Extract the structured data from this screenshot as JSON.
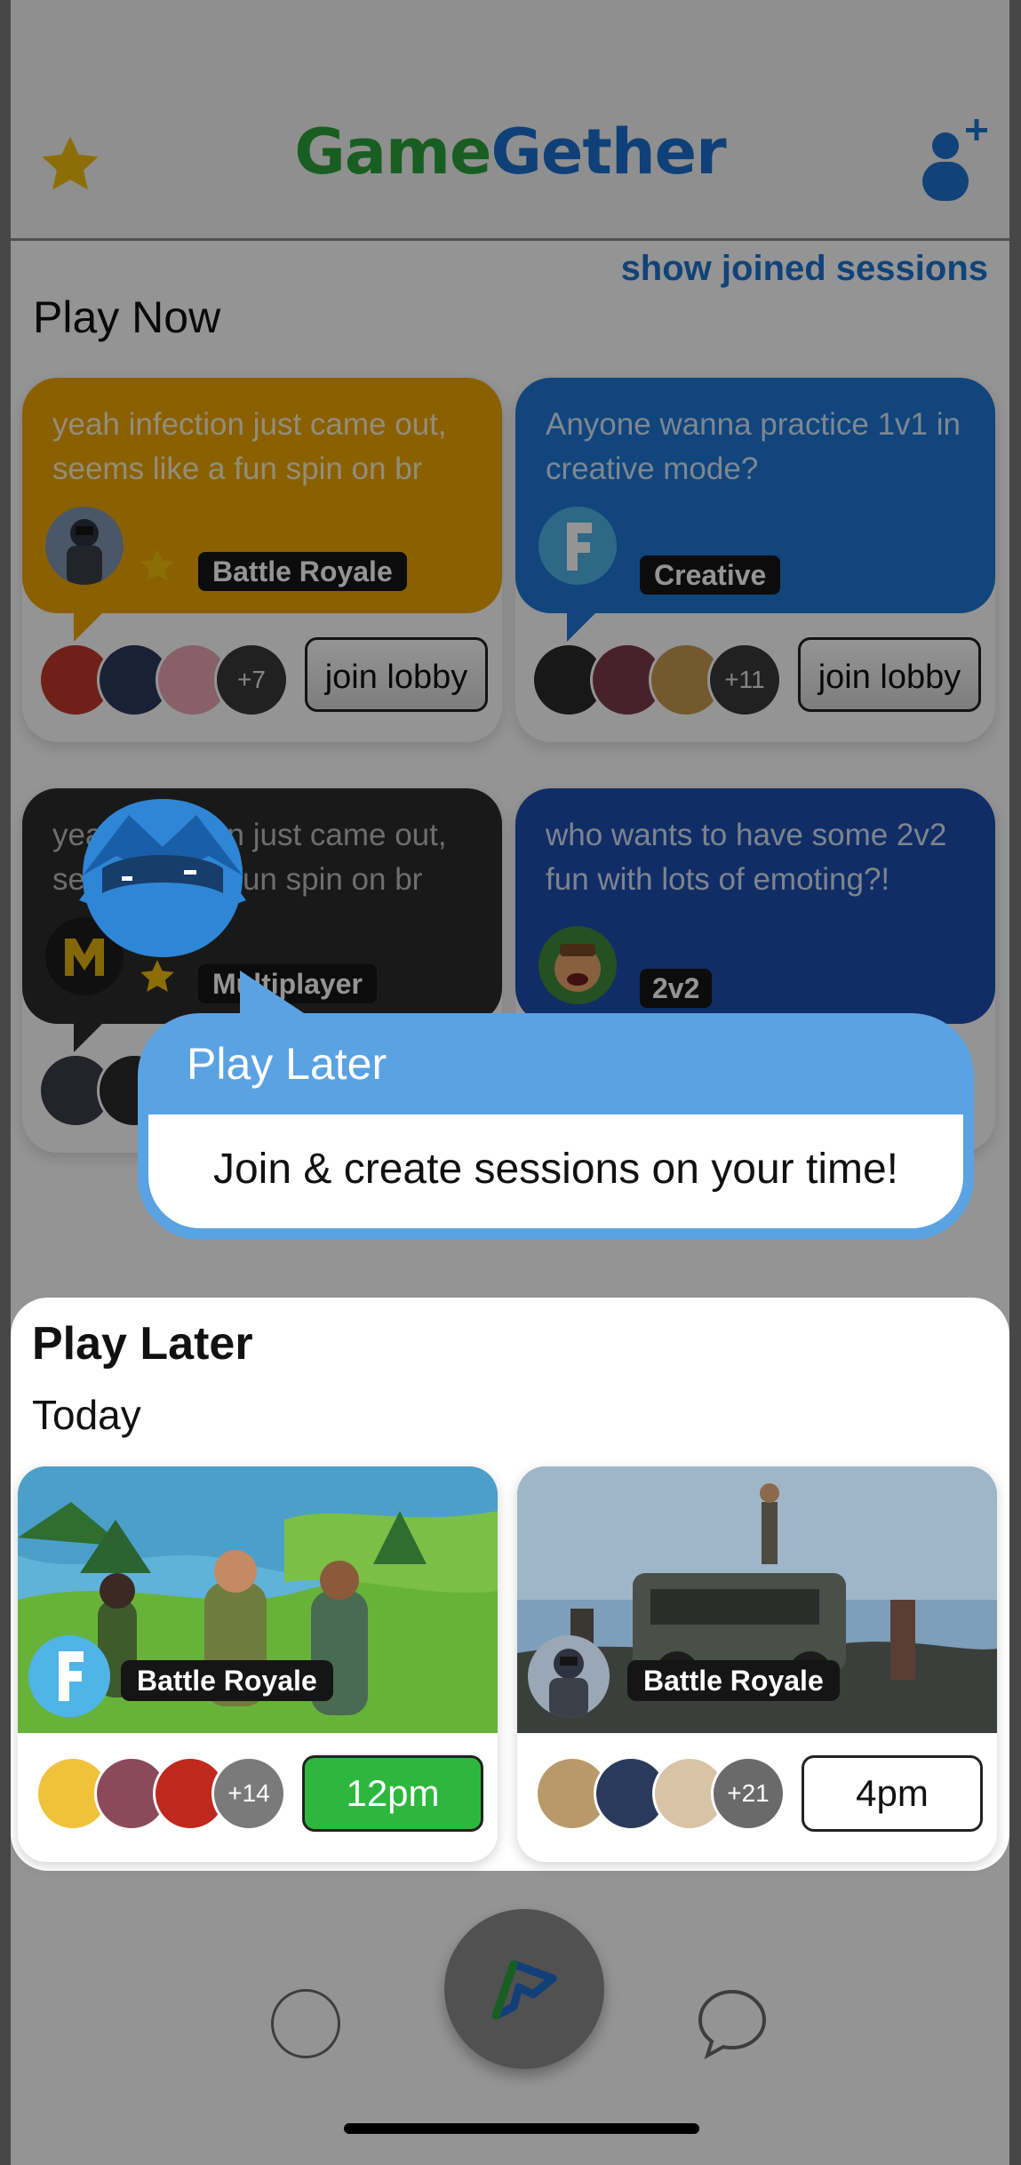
{
  "app": {
    "title_part1": "Game",
    "title_part2": "Gether",
    "show_joined": "show joined sessions"
  },
  "play_now": {
    "heading": "Play Now",
    "sessions": [
      {
        "message": "yeah infection just came out, seems like a fun spin on br",
        "tag": "Battle Royale",
        "extra_count": "+7",
        "button": "join lobby",
        "color": "#f0a500",
        "favorite": true,
        "game_icon": "pubg-icon"
      },
      {
        "message": "Anyone wanna practice 1v1 in creative mode?",
        "tag": "Creative",
        "extra_count": "+11",
        "button": "join lobby",
        "color": "#1e78d4",
        "favorite": false,
        "game_icon": "fortnite-icon"
      },
      {
        "message": "yeah infection just came out, seems like a fun spin on br",
        "tag": "Multiplayer",
        "extra_count": "",
        "button": "",
        "color": "#2b2b2b",
        "favorite": true,
        "game_icon": "cod-mobile-icon"
      },
      {
        "message": "who wants to have some 2v2 fun with lots of emoting?!",
        "tag": "2v2",
        "extra_count": "",
        "button": "",
        "color": "#1e4fae",
        "favorite": false,
        "game_icon": "clash-royale-icon"
      }
    ]
  },
  "tooltip": {
    "title": "Play Later",
    "body": "Join & create sessions on your time!"
  },
  "play_later": {
    "heading": "Play Later",
    "day": "Today",
    "sessions": [
      {
        "tag": "Battle Royale",
        "extra_count": "+14",
        "time": "12pm",
        "selected": true,
        "game_icon": "fortnite-icon"
      },
      {
        "tag": "Battle Royale",
        "extra_count": "+21",
        "time": "4pm",
        "selected": false,
        "game_icon": "pubg-icon"
      }
    ]
  },
  "colors": {
    "brand_green": "#2aa33b",
    "brand_blue": "#1b6fcf",
    "tooltip_blue": "#5aa2e2",
    "selected_time": "#2db83d"
  }
}
